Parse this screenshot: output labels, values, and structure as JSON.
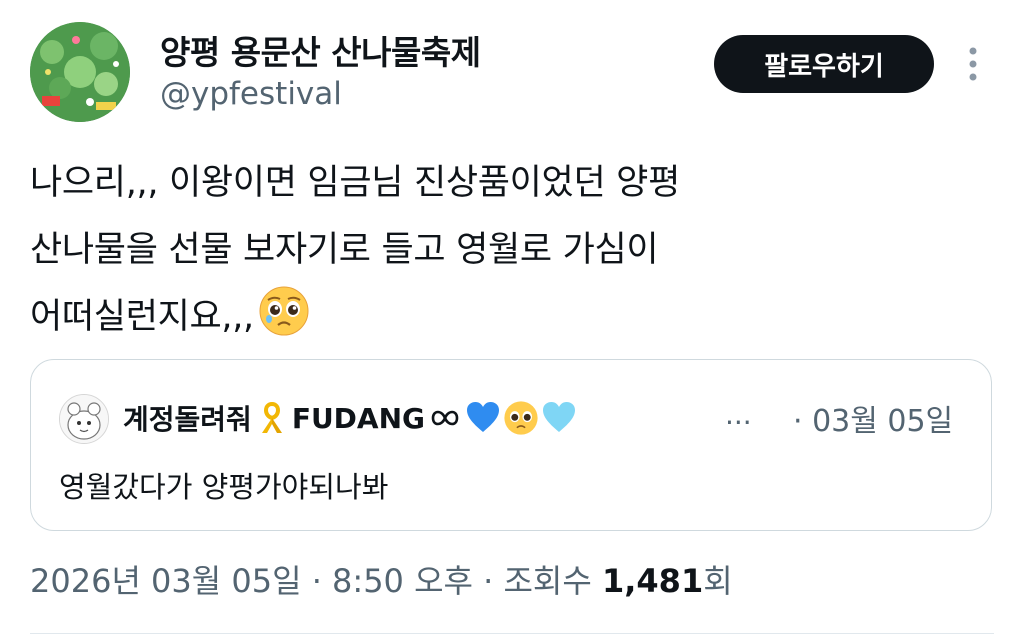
{
  "author": {
    "display_name": "양평 용문산 산나물축제",
    "handle": "@ypfestival",
    "avatar_icon": "festival-avatar-icon"
  },
  "actions": {
    "follow_label": "팔로우하기",
    "more_icon": "more-vertical-icon"
  },
  "post": {
    "lines": [
      "나으리,,, 이왕이면 임금님 진상품이었던 양평",
      "산나물을 선물 보자기로 들고 영월로 가심이",
      "어떠실런지요,,,"
    ],
    "trailing_emoji": "pleading-face-emoji"
  },
  "quote": {
    "author_name": "계정돌려줘",
    "author_name_suffix": "FUDANG",
    "name_icons": [
      "yellow-ribbon-emoji",
      "infinity-symbol",
      "blue-heart-emoji",
      "pleading-face-emoji",
      "light-blue-heart-emoji"
    ],
    "ellipsis": "...",
    "date": "· 03월 05일",
    "text": "영월갔다가 양평가야되나봐"
  },
  "meta": {
    "timestamp": "2026년 03월 05일 · 8:50 오후 · 조회수 ",
    "view_count": "1,481",
    "view_unit": "회"
  },
  "colors": {
    "text_primary": "#0f1419",
    "text_secondary": "#536471",
    "border": "#cfd9de",
    "follow_bg": "#0f1419"
  }
}
